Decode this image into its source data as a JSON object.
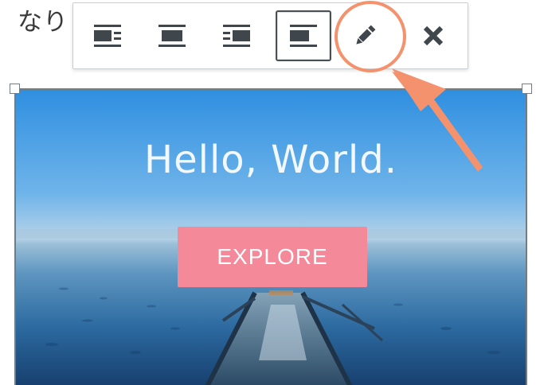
{
  "background_text": "なり",
  "toolbar": {
    "buttons": [
      {
        "name": "align-left",
        "active": false
      },
      {
        "name": "align-center",
        "active": false
      },
      {
        "name": "align-right",
        "active": false
      },
      {
        "name": "align-none",
        "active": true
      },
      {
        "name": "edit",
        "active": false
      },
      {
        "name": "remove",
        "active": false
      }
    ]
  },
  "image": {
    "title": "Hello, World.",
    "button_label": "EXPLORE"
  },
  "annotation": {
    "ring_color": "#f5926e",
    "arrow_color": "#f5926e"
  },
  "colors": {
    "button_bg": "#f4899a",
    "toolbar_icon": "#3f464c"
  }
}
